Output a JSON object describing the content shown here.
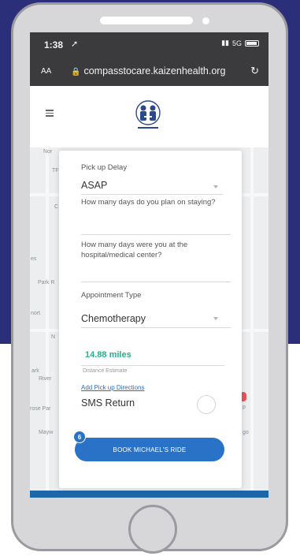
{
  "status_bar": {
    "time": "1:38",
    "location_icon": "location-arrow-icon",
    "network": "5G",
    "battery_icon": "battery-icon"
  },
  "browser": {
    "text_size": "AA",
    "url": "compasstocare.kaizenhealth.org",
    "lock_icon": "lock-icon",
    "reload_icon": "reload-icon"
  },
  "header": {
    "menu_icon": "menu-icon",
    "logo_icon": "compass-to-care-logo-icon"
  },
  "map": {
    "labels": [
      "Nor",
      "TF",
      "C",
      "es",
      "Park R",
      "nort",
      "N",
      "ark",
      "River",
      "rose Par",
      "Mayw",
      "p",
      "go"
    ]
  },
  "form": {
    "pickup_delay_label": "Pick up Delay",
    "pickup_delay_value": "ASAP",
    "stay_days_label": "How many days do you plan on staying?",
    "hospital_days_label_line1": "How many days were you at the",
    "hospital_days_label_line2": "hospital/medical center?",
    "appointment_type_label": "Appointment Type",
    "appointment_type_value": "Chemotherapy",
    "distance_value": "14.88 miles",
    "distance_label": "Distance Estimate",
    "add_directions_link": "Add Pick up Directions",
    "sms_return_label": "SMS Return",
    "book_button_label": "BOOK MICHAEL'S RIDE",
    "badge_count": "6"
  },
  "colors": {
    "background_navy": "#2b2f7a",
    "button_blue": "#2a72c8",
    "miles_green": "#26b08d",
    "link_blue": "#2a6ebd"
  }
}
